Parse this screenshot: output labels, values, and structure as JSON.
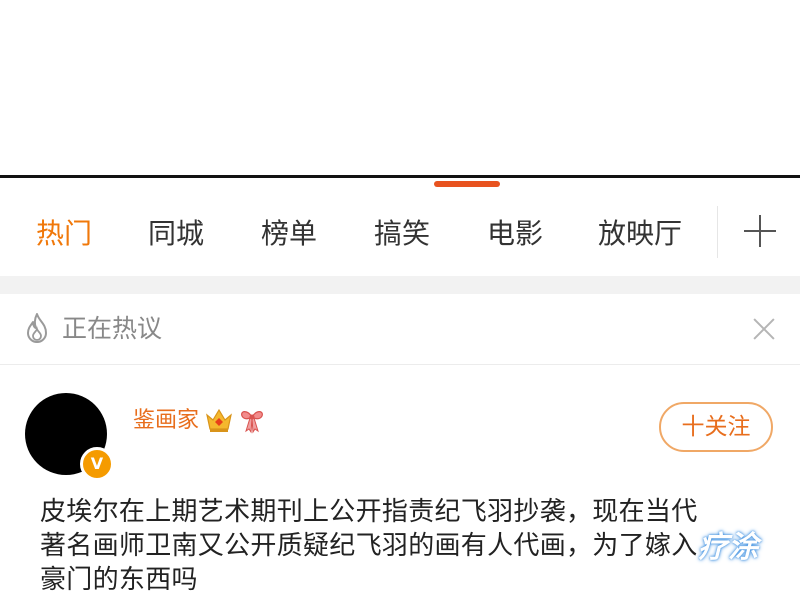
{
  "tabs": [
    {
      "label": "热门",
      "active": true
    },
    {
      "label": "同城",
      "active": false
    },
    {
      "label": "榜单",
      "active": false
    },
    {
      "label": "搞笑",
      "active": false
    },
    {
      "label": "电影",
      "active": false
    },
    {
      "label": "放映厅",
      "active": false
    }
  ],
  "hot_bar": {
    "label": "正在热议"
  },
  "post": {
    "username": "鉴画家",
    "follow_label": "十关注",
    "verified_badge": "V",
    "lines": [
      "皮埃尔在上期艺术期刊上公开指责纪飞羽抄袭，现在当代",
      "著名画师卫南又公开质疑纪飞羽的画有人代画，为了嫁入",
      "豪门的东西吗"
    ]
  },
  "watermark": {
    "text": "疗涂"
  },
  "colors": {
    "accent": "#f0780a",
    "handle": "#e8531f",
    "username": "#e86e1d",
    "badge": "#f59b00"
  }
}
